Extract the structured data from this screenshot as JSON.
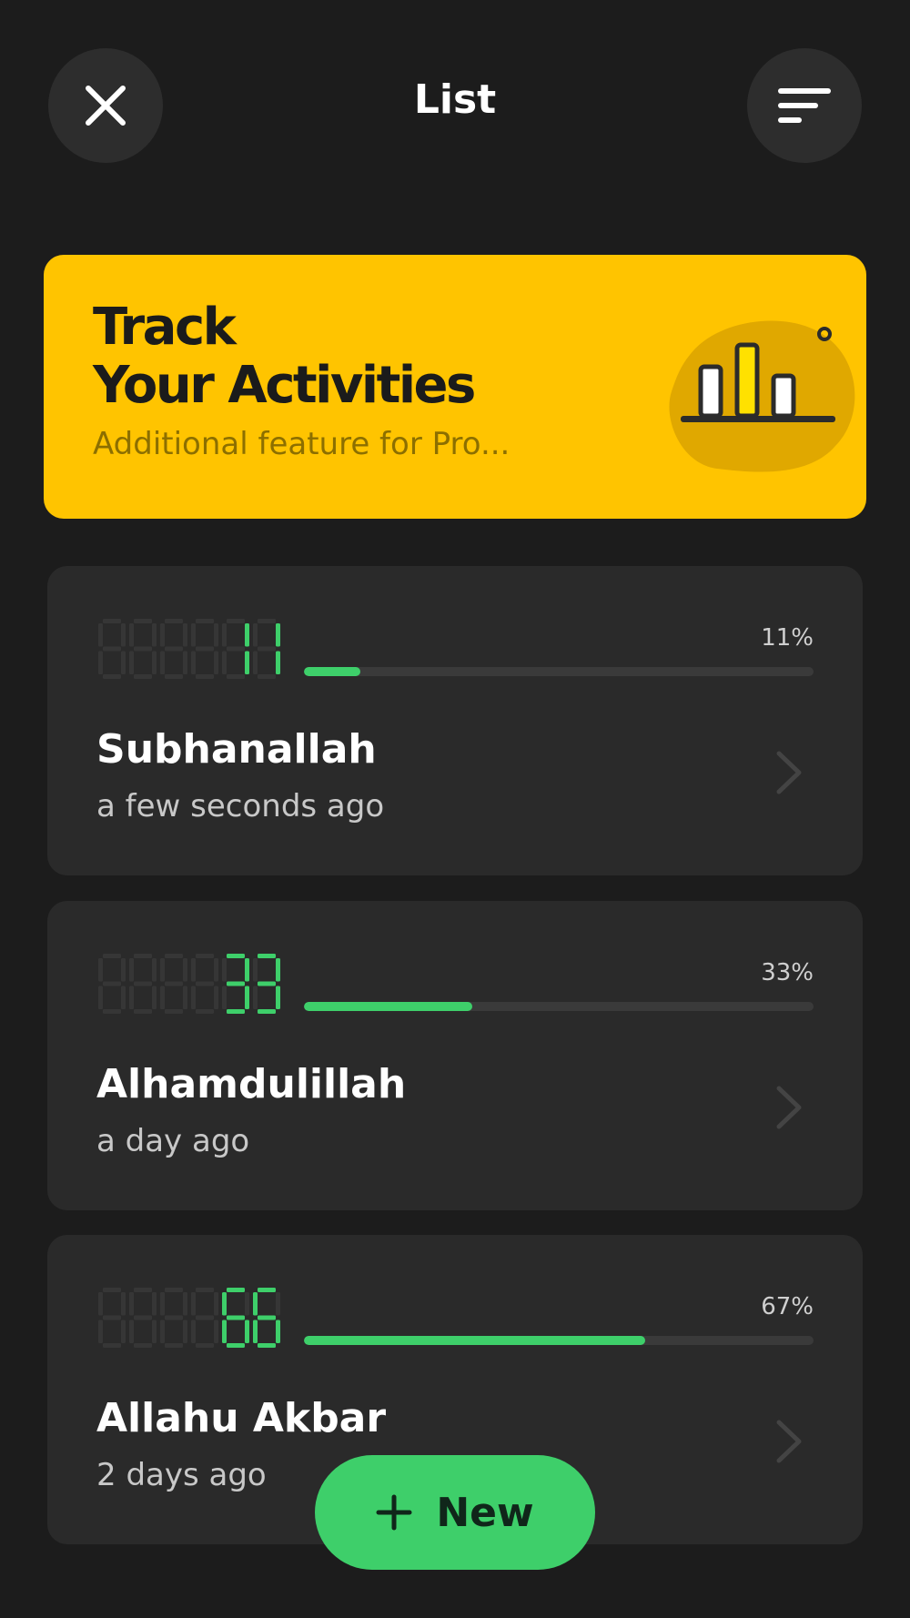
{
  "header": {
    "title": "List",
    "close_icon": "close-icon",
    "sort_icon": "sort-icon"
  },
  "promo": {
    "title_line1": "Track",
    "title_line2": "Your Activities",
    "subtitle": "Additional feature for Pro...",
    "icon": "bar-chart-illustration",
    "background_color": "#ffc400"
  },
  "items": [
    {
      "counter": "000011",
      "percent_label": "11%",
      "progress": 0.11,
      "title": "Subhanallah",
      "time": "a few seconds ago"
    },
    {
      "counter": "000033",
      "percent_label": "33%",
      "progress": 0.33,
      "title": "Alhamdulillah",
      "time": "a day ago"
    },
    {
      "counter": "000066",
      "percent_label": "67%",
      "progress": 0.67,
      "title": "Allahu Akbar",
      "time": "2 days ago"
    }
  ],
  "new_button": {
    "label": "New",
    "icon": "plus-icon"
  },
  "colors": {
    "background": "#1c1c1c",
    "card": "#2a2a2a",
    "accent_green": "#3ecf6a",
    "promo_yellow": "#ffc400"
  }
}
